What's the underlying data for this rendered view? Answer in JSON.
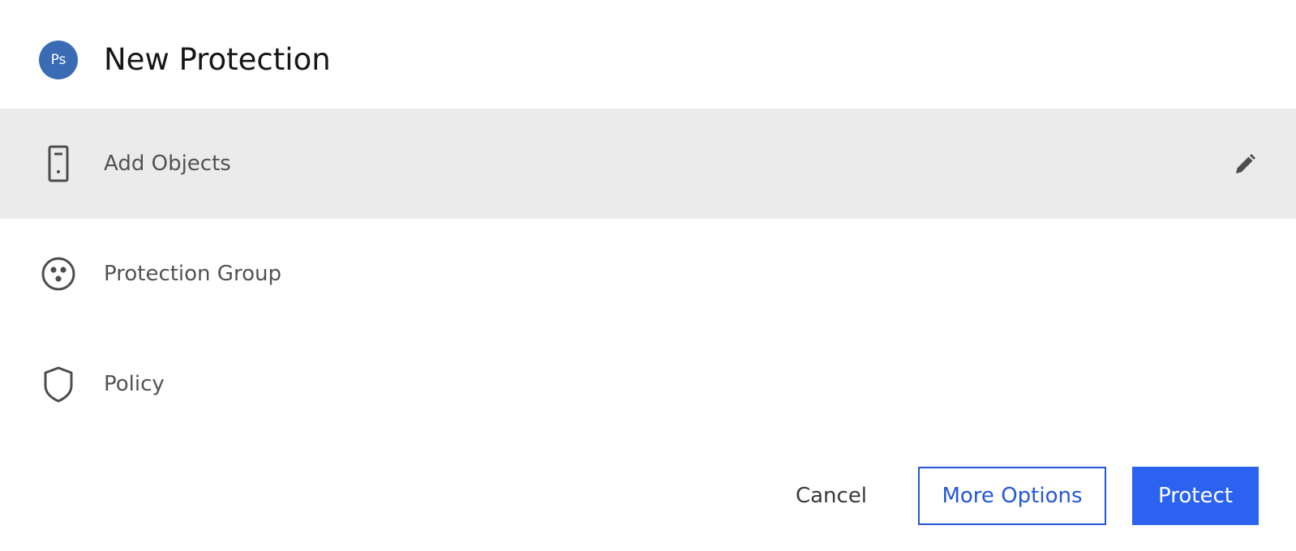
{
  "dialog": {
    "avatar_text": "Ps",
    "title": "New Protection"
  },
  "rows": [
    {
      "label": "Add Objects",
      "icon": "server-icon",
      "active": true,
      "edit_icon": "pencil-icon"
    },
    {
      "label": "Protection Group",
      "icon": "group-icon",
      "active": false
    },
    {
      "label": "Policy",
      "icon": "shield-icon",
      "active": false
    }
  ],
  "footer": {
    "cancel_label": "Cancel",
    "more_options_label": "More Options",
    "protect_label": "Protect"
  },
  "colors": {
    "avatar_bg": "#3a6bb5",
    "active_row_bg": "#ebebeb",
    "primary_button": "#2b63f0",
    "secondary_border": "#2457d6"
  }
}
